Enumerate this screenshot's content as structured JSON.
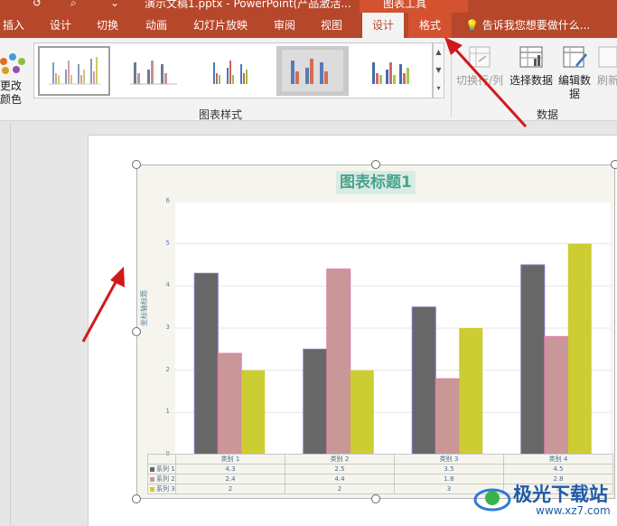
{
  "window": {
    "title": "演示文稿1.pptx - PowerPoint(产品激活...",
    "context_group": "图表工具"
  },
  "tabs": [
    {
      "label": "插入"
    },
    {
      "label": "设计"
    },
    {
      "label": "切换"
    },
    {
      "label": "动画"
    },
    {
      "label": "幻灯片放映"
    },
    {
      "label": "审阅"
    },
    {
      "label": "视图"
    },
    {
      "label": "设计"
    },
    {
      "label": "格式"
    }
  ],
  "tell_me": "告诉我您想要做什么...",
  "ribbon": {
    "recolor_label": "更改\n颜色",
    "group_chart_styles": "图表样式",
    "group_data": "数据",
    "switch_row_col": "切换行/列",
    "select_data": "选择数据",
    "edit_data": "编辑数\n据",
    "refresh_data": "刷新"
  },
  "chart_data": {
    "type": "bar",
    "title": "图表标题1",
    "ylabel": "坐标轴标题",
    "ylim": [
      0,
      6
    ],
    "yticks": [
      "0",
      "1",
      "2",
      "3",
      "4",
      "5",
      "6"
    ],
    "categories": [
      "类别 1",
      "类别 2",
      "类别 3",
      "类别 4"
    ],
    "series": [
      {
        "name": "系列 1",
        "values": [
          4.3,
          2.5,
          3.5,
          4.5
        ],
        "color": "#676767"
      },
      {
        "name": "系列 2",
        "values": [
          2.4,
          4.4,
          1.8,
          2.8
        ],
        "color": "#c99797"
      },
      {
        "name": "系列 3",
        "values": [
          2,
          2,
          3,
          5
        ],
        "color": "#cccc33"
      }
    ],
    "table": [
      {
        "key": "系列 1",
        "values": [
          "4.3",
          "2.5",
          "3.5",
          "4.5"
        ]
      },
      {
        "key": "系列 2",
        "values": [
          "2.4",
          "4.4",
          "1.8",
          "2.8"
        ]
      },
      {
        "key": "系列 3",
        "values": [
          "2",
          "2",
          "3",
          "5"
        ]
      }
    ],
    "grid": true,
    "legend": "none (data table with legend keys)"
  },
  "watermark": {
    "name": "极光下载站",
    "url": "www.xz7.com"
  },
  "colors": {
    "accent": "#b7472a",
    "context_tab": "#d35230",
    "title_text": "#4aa38e",
    "arrow": "#d01a1a"
  }
}
